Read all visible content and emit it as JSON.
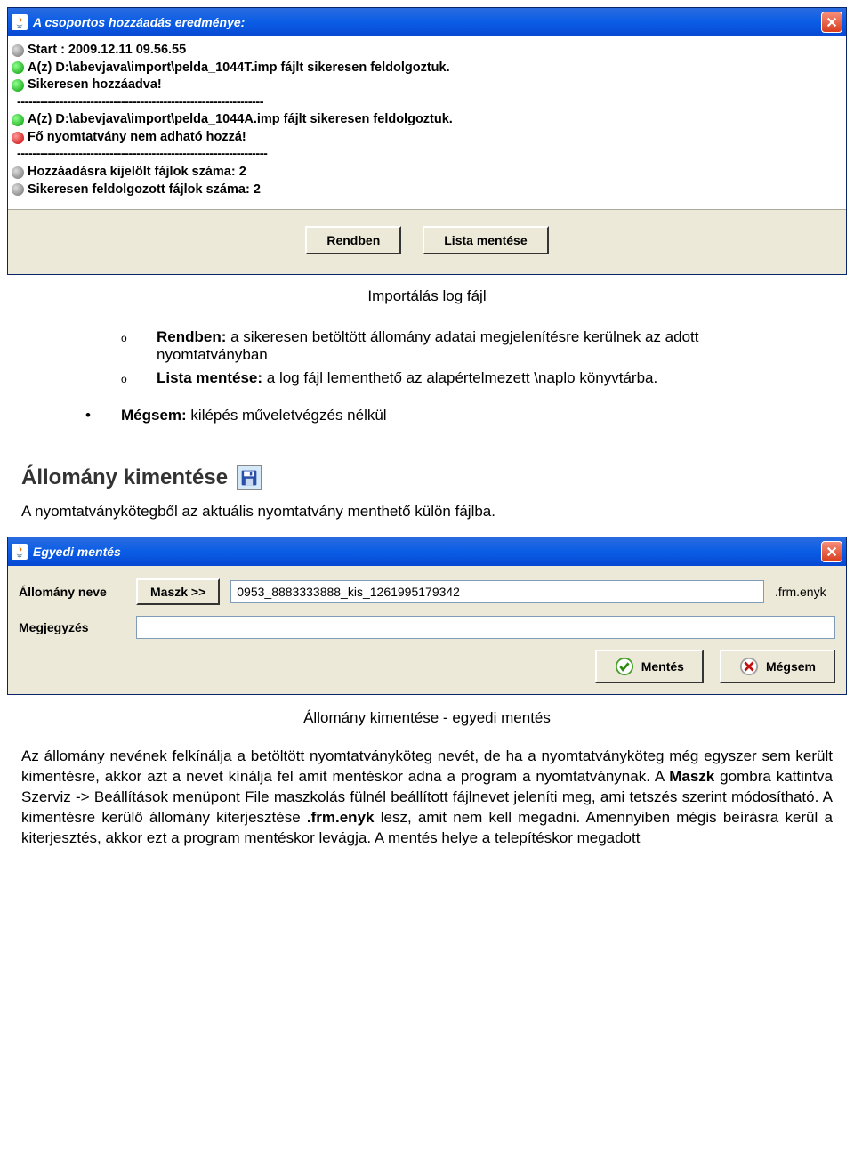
{
  "dialog1": {
    "title": "A csoportos hozzáadás eredménye:",
    "log": [
      {
        "dot": "grey",
        "text": "Start : 2009.12.11 09.56.55"
      },
      {
        "dot": "green",
        "text": "A(z) D:\\abevjava\\import\\pelda_1044T.imp fájlt sikeresen feldolgoztuk."
      },
      {
        "dot": "green",
        "text": "Sikeresen hozzáadva!"
      },
      {
        "sep": "----------------------------------------------------------------"
      },
      {
        "dot": "green",
        "text": "A(z) D:\\abevjava\\import\\pelda_1044A.imp fájlt sikeresen feldolgoztuk."
      },
      {
        "dot": "red",
        "text": "Fő nyomtatvány nem adható hozzá!"
      },
      {
        "sep": "-----------------------------------------------------------------"
      },
      {
        "dot": "grey",
        "text": "Hozzáadásra kijelölt fájlok száma: 2"
      },
      {
        "dot": "grey",
        "text": "Sikeresen feldolgozott fájlok száma: 2"
      }
    ],
    "buttons": {
      "ok": "Rendben",
      "save": "Lista mentése"
    }
  },
  "doc1": {
    "caption": "Importálás log fájl",
    "item1_label": "Rendben:",
    "item1_text": " a sikeresen betöltött állomány adatai megjelenítésre kerülnek az adott nyomtatványban",
    "item2_label": "Lista mentése:",
    "item2_text": " a log fájl lementhető az alapértelmezett \\naplo könyvtárba.",
    "item3_label": "Mégsem:",
    "item3_text": " kilépés műveletvégzés nélkül"
  },
  "section": {
    "heading": "Állomány kimentése",
    "sub": "A nyomtatványkötegből az aktuális nyomtatvány menthető külön fájlba."
  },
  "dialog2": {
    "title": "Egyedi mentés",
    "label_name": "Állomány neve",
    "mask_btn": "Maszk >>",
    "filename_value": "0953_8883333888_kis_1261995179342",
    "ext": ".frm.enyk",
    "label_note": "Megjegyzés",
    "note_value": "",
    "btn_save": "Mentés",
    "btn_cancel": "Mégsem"
  },
  "doc2": {
    "caption": "Állomány kimentése - egyedi mentés",
    "p1a": "Az állomány nevének felkínálja a betöltött nyomtatványköteg nevét, de ha a nyomtatványköteg még egyszer sem került kimentésre, akkor azt a nevet kínálja fel amit mentéskor adna a program a nyomtatványnak.",
    "p1b_pre": "A ",
    "p1b_bold": "Maszk",
    "p1b_post": " gombra kattintva Szerviz -> Beállítások menüpont File maszkolás fülnél beállított fájlnevet jeleníti meg, ami tetszés szerint módosítható.",
    "p2_pre": "A kimentésre kerülő állomány kiterjesztése ",
    "p2_bold": ".frm.enyk",
    "p2_post": " lesz, amit nem kell megadni. Amennyiben mégis beírásra kerül a kiterjesztés, akkor ezt a program mentéskor levágja. A mentés helye a telepítéskor megadott"
  }
}
